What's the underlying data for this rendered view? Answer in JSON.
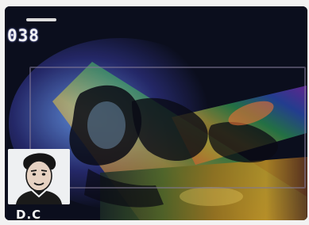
{
  "hud": {
    "counter": "038",
    "player_initials": "D.C"
  },
  "colors": {
    "frame": "#0d1020",
    "hud_text": "#f2f2f2",
    "portrait_bg": "#eef0f2"
  }
}
